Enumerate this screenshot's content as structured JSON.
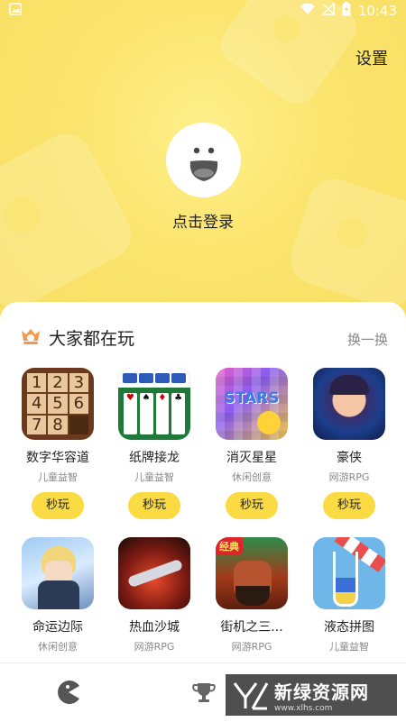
{
  "status": {
    "time": "10:43"
  },
  "header": {
    "settings_label": "设置",
    "login_label": "点击登录"
  },
  "section": {
    "title": "大家都在玩",
    "refresh_label": "换一换"
  },
  "games": [
    {
      "name": "数字华容道",
      "category": "儿童益智",
      "play": "秒玩",
      "icon": "number-puzzle-icon"
    },
    {
      "name": "纸牌接龙",
      "category": "儿童益智",
      "play": "秒玩",
      "icon": "solitaire-icon"
    },
    {
      "name": "消灭星星",
      "category": "休闲创意",
      "play": "秒玩",
      "icon": "pop-stars-icon"
    },
    {
      "name": "豪侠",
      "category": "网游RPG",
      "play": "秒玩",
      "icon": "hero-icon"
    },
    {
      "name": "命运边际",
      "category": "休闲创意",
      "icon": "fate-icon"
    },
    {
      "name": "热血沙城",
      "category": "网游RPG",
      "icon": "sand-city-icon"
    },
    {
      "name": "街机之三...",
      "category": "网游RPG",
      "icon": "arcade-three-icon",
      "badge": "经典"
    },
    {
      "name": "液态拼图",
      "category": "儿童益智",
      "icon": "liquid-puzzle-icon"
    }
  ],
  "puzzle_numbers": [
    "1",
    "2",
    "3",
    "4",
    "5",
    "6",
    "7",
    "8"
  ],
  "pop_stars_text": "STARS",
  "watermark": {
    "text": "新绿资源网",
    "sub": "www.xlhs.com"
  },
  "colors": {
    "accent": "#FADB44",
    "hero_bg": "#FBE36A"
  }
}
